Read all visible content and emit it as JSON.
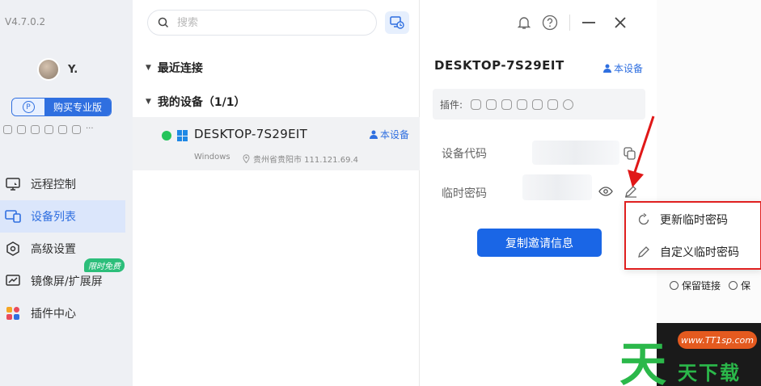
{
  "app": {
    "version": "V4.7.0.2"
  },
  "user": {
    "name": "Y."
  },
  "sidebar": {
    "buy_badge": "P",
    "buy_label": "购买专业版",
    "more": "···",
    "free_tag": "限时免费",
    "items": [
      {
        "label": "远程控制",
        "icon": "remote-control-icon"
      },
      {
        "label": "设备列表",
        "icon": "device-list-icon"
      },
      {
        "label": "高级设置",
        "icon": "settings-icon"
      },
      {
        "label": "镜像屏/扩展屏",
        "icon": "mirror-screen-icon"
      },
      {
        "label": "插件中心",
        "icon": "plugin-center-icon"
      }
    ]
  },
  "search": {
    "placeholder": "搜索"
  },
  "device_list": {
    "recent_label": "最近连接",
    "mine_label": "我的设备（1/1）",
    "device": {
      "name": "DESKTOP-7S29EIT",
      "tag": "本设备",
      "os": "Windows",
      "location": "贵州省贵阳市 111.121.69.4",
      "online": true
    }
  },
  "detail": {
    "title": "DESKTOP-7S29EIT",
    "tag": "本设备",
    "plugins_label": "插件:",
    "device_code_label": "设备代码",
    "temp_password_label": "临时密码",
    "copy_invite_label": "复制邀请信息"
  },
  "popup": {
    "refresh_label": "更新临时密码",
    "custom_label": "自定义临时密码"
  },
  "background": {
    "keep_link": "保留链接",
    "keep_link_2": "保",
    "promo": "www.TT1sp.com",
    "watermark_big": "天",
    "watermark_small": "天下载"
  },
  "colors": {
    "accent": "#1a66e6",
    "online": "#24c45a",
    "highlight": "#e02020",
    "free_tag": "#2cbe7a"
  }
}
